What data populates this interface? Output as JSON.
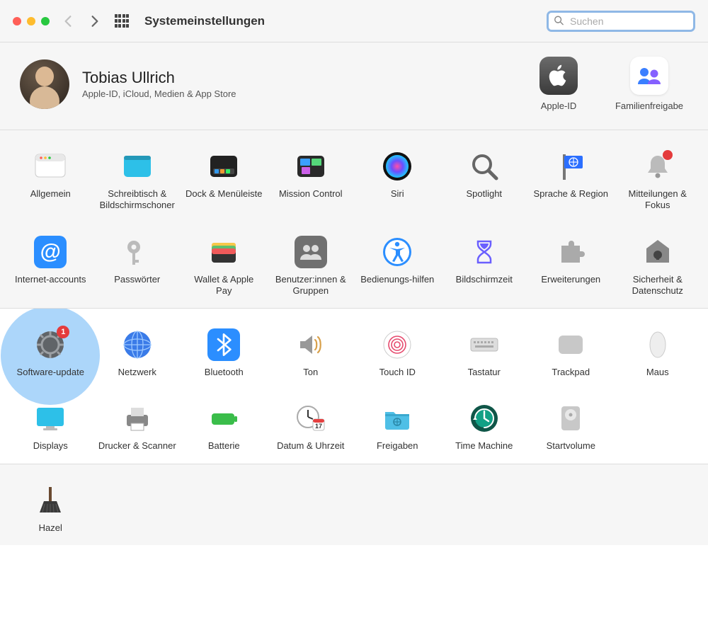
{
  "toolbar": {
    "title": "Systemeinstellungen",
    "search_placeholder": "Suchen"
  },
  "user": {
    "name": "Tobias Ullrich",
    "subtitle": "Apple-ID, iCloud, Medien & App Store"
  },
  "accounts": {
    "apple_id": {
      "label": "Apple-ID"
    },
    "family": {
      "label": "Familienfreigabe"
    }
  },
  "row1": [
    {
      "id": "general",
      "label": "Allgemein"
    },
    {
      "id": "desktop",
      "label": "Schreibtisch & Bildschirmschoner"
    },
    {
      "id": "dock",
      "label": "Dock & Menüleiste"
    },
    {
      "id": "mission",
      "label": "Mission Control"
    },
    {
      "id": "siri",
      "label": "Siri"
    },
    {
      "id": "spotlight",
      "label": "Spotlight"
    },
    {
      "id": "region",
      "label": "Sprache & Region"
    },
    {
      "id": "notifications",
      "label": "Mitteilungen & Fokus",
      "badge": ""
    }
  ],
  "row2": [
    {
      "id": "internet",
      "label": "Internet-accounts"
    },
    {
      "id": "passwords",
      "label": "Passwörter"
    },
    {
      "id": "wallet",
      "label": "Wallet & Apple Pay"
    },
    {
      "id": "users",
      "label": "Benutzer:innen & Gruppen"
    },
    {
      "id": "accessibility",
      "label": "Bedienungs-hilfen"
    },
    {
      "id": "screentime",
      "label": "Bildschirmzeit"
    },
    {
      "id": "extensions",
      "label": "Erweiterungen"
    },
    {
      "id": "security",
      "label": "Sicherheit & Datenschutz"
    }
  ],
  "row3": [
    {
      "id": "software-update",
      "label": "Software-update",
      "badge": "1",
      "highlight": true
    },
    {
      "id": "network",
      "label": "Netzwerk"
    },
    {
      "id": "bluetooth",
      "label": "Bluetooth"
    },
    {
      "id": "sound",
      "label": "Ton"
    },
    {
      "id": "touchid",
      "label": "Touch ID"
    },
    {
      "id": "keyboard",
      "label": "Tastatur"
    },
    {
      "id": "trackpad",
      "label": "Trackpad"
    },
    {
      "id": "mouse",
      "label": "Maus"
    }
  ],
  "row4": [
    {
      "id": "displays",
      "label": "Displays"
    },
    {
      "id": "printers",
      "label": "Drucker & Scanner"
    },
    {
      "id": "battery",
      "label": "Batterie"
    },
    {
      "id": "datetime",
      "label": "Datum & Uhrzeit",
      "day": "17"
    },
    {
      "id": "sharing",
      "label": "Freigaben"
    },
    {
      "id": "timemachine",
      "label": "Time Machine"
    },
    {
      "id": "startup",
      "label": "Startvolume"
    }
  ],
  "row5": [
    {
      "id": "hazel",
      "label": "Hazel"
    }
  ]
}
